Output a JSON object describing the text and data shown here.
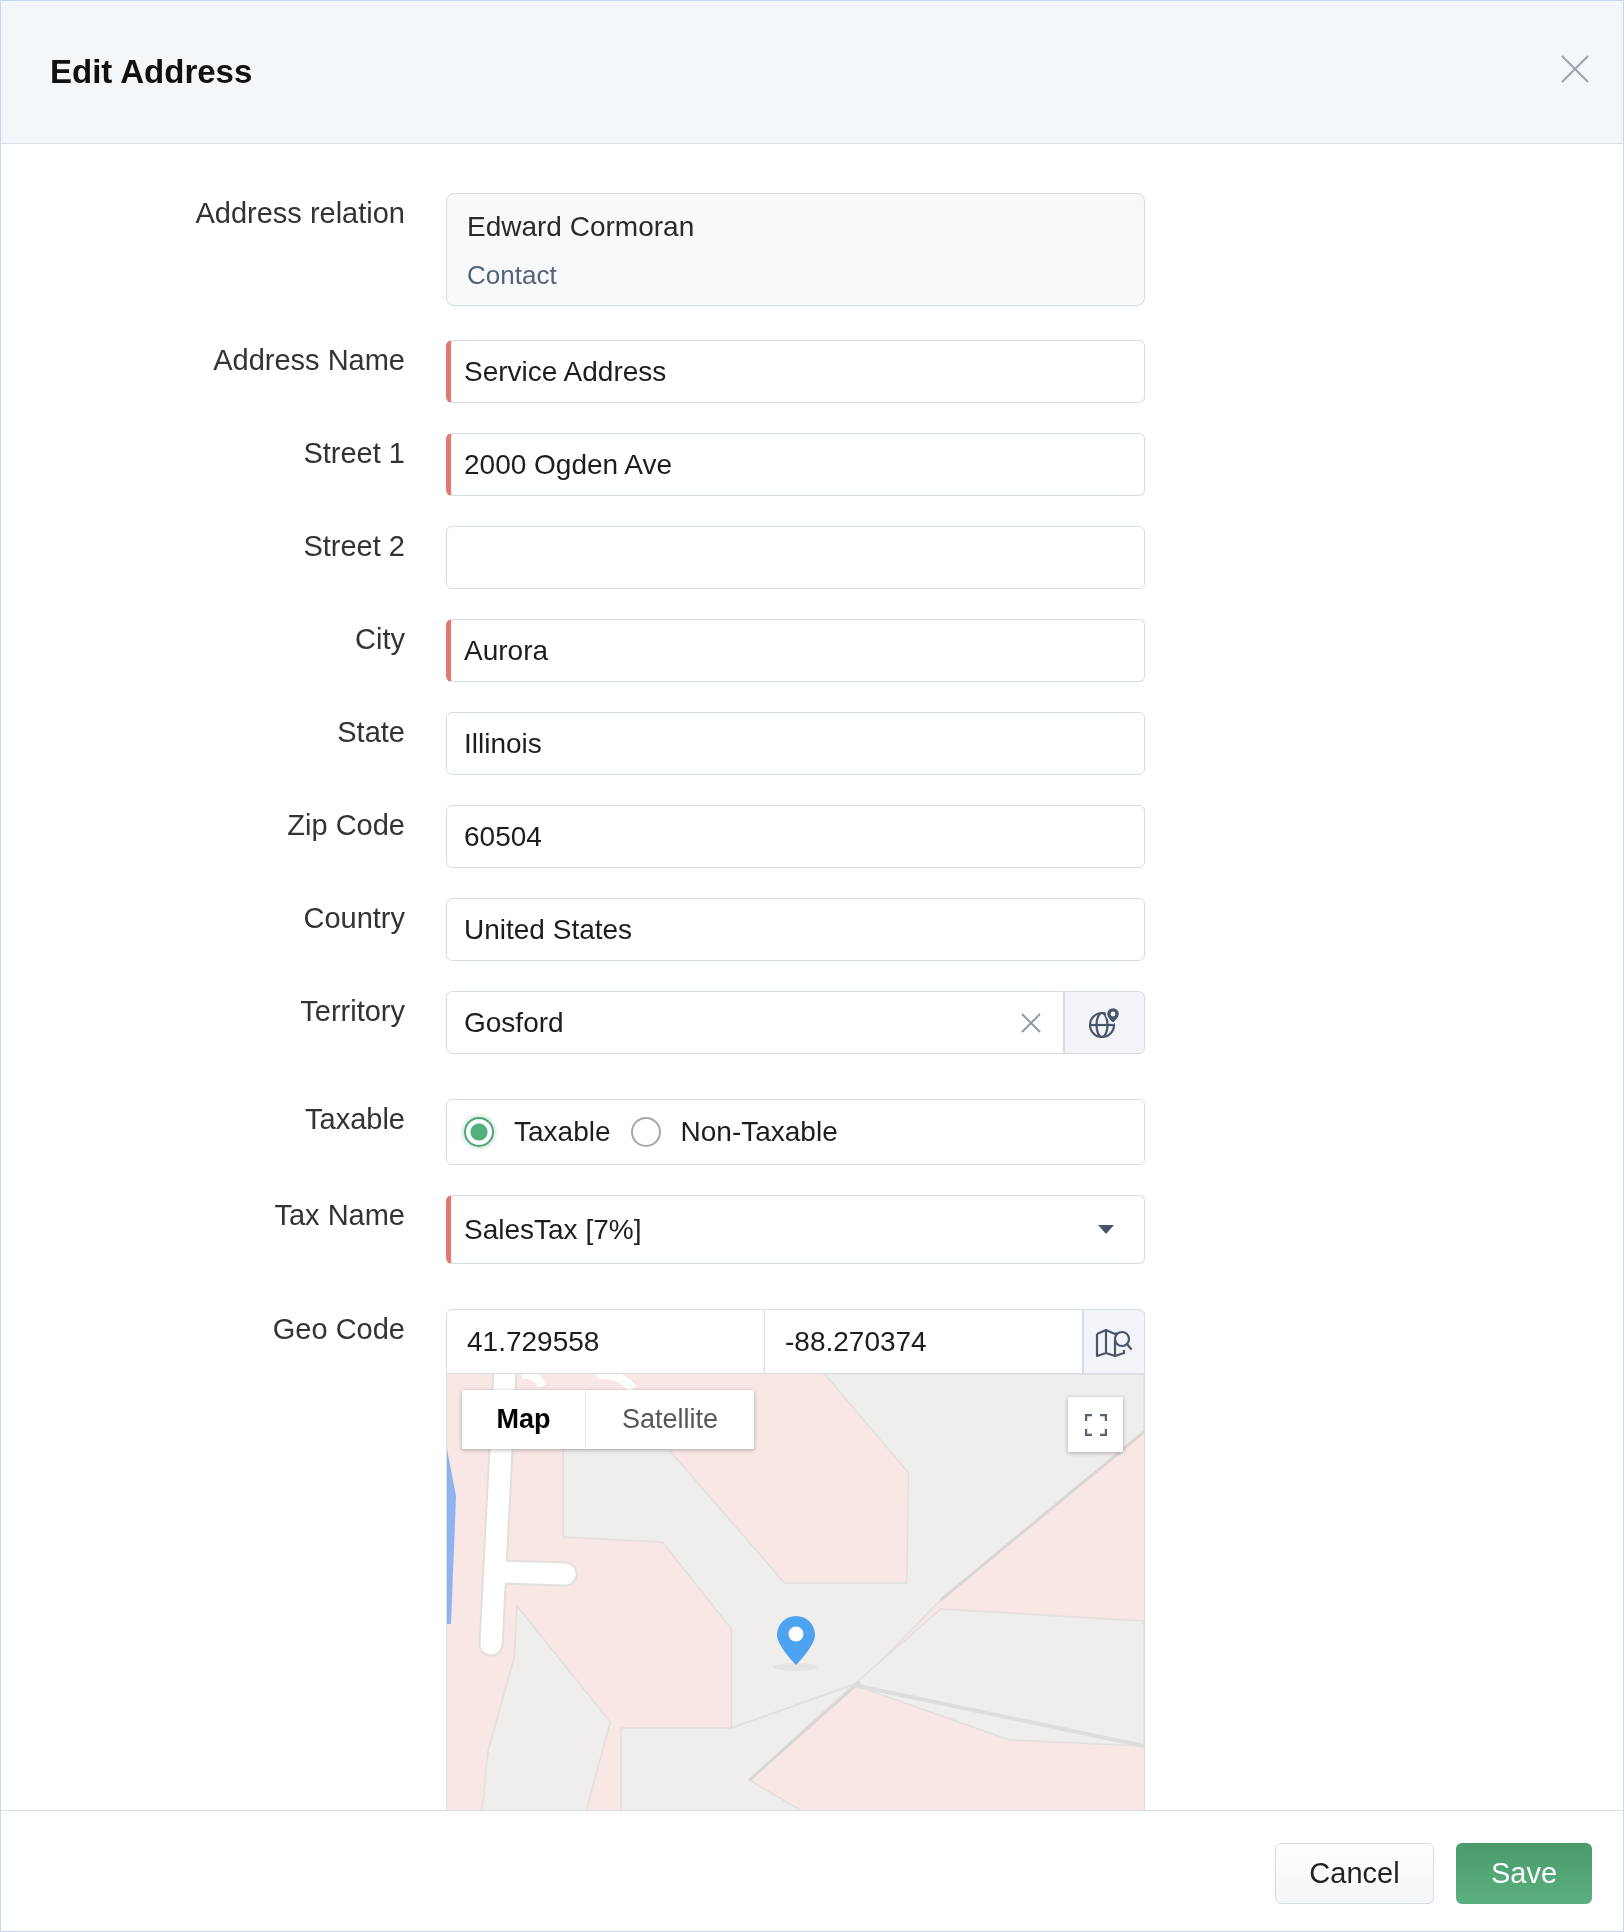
{
  "dialog": {
    "title": "Edit Address"
  },
  "form": {
    "fields": [
      {
        "kind": "relation",
        "label": "Address relation",
        "name": "Edward Cormoran",
        "relation": "Contact"
      },
      {
        "kind": "text",
        "label": "Address Name",
        "value": "Service Address",
        "required": true
      },
      {
        "kind": "text",
        "label": "Street 1",
        "value": "2000 Ogden Ave",
        "required": true
      },
      {
        "kind": "text",
        "label": "Street 2",
        "required": false
      },
      {
        "kind": "text",
        "label": "City",
        "value": "Aurora",
        "required": true
      },
      {
        "kind": "text",
        "label": "State",
        "value": "Illinois",
        "required": false
      },
      {
        "kind": "text",
        "label": "Zip Code",
        "value": "60504",
        "required": false
      },
      {
        "kind": "text",
        "label": "Country",
        "value": "United States",
        "required": false
      },
      {
        "kind": "lookup",
        "label": "Territory",
        "value": "Gosford",
        "required": false
      },
      {
        "kind": "radio",
        "label": "Taxable",
        "options": [
          {
            "label": "Taxable",
            "selected": true
          },
          {
            "label": "Non-Taxable",
            "selected": false
          }
        ]
      },
      {
        "kind": "select",
        "label": "Tax Name",
        "value": "SalesTax [7%]",
        "required": true
      },
      {
        "kind": "geo",
        "label": "Geo Code",
        "latitude": "41.729558",
        "longitude": "-88.270374",
        "map": {
          "view_tabs": [
            {
              "label": "Map",
              "selected": true
            },
            {
              "label": "Satellite",
              "selected": false
            }
          ]
        }
      }
    ]
  },
  "footer": {
    "buttons": [
      {
        "label": "Cancel",
        "kind": "secondary"
      },
      {
        "label": "Save",
        "kind": "primary"
      }
    ]
  }
}
